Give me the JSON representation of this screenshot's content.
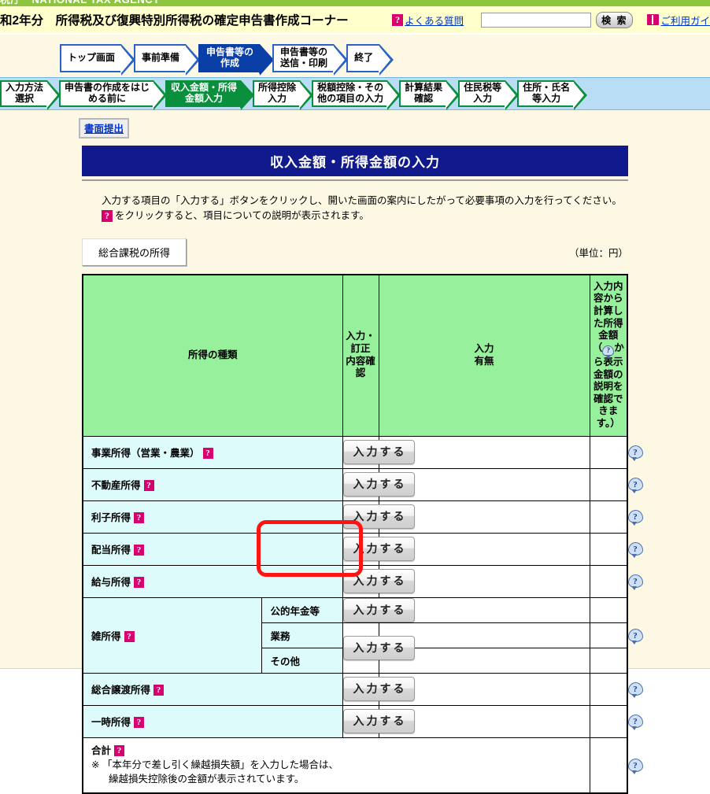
{
  "agency": {
    "strip_text": "税庁　NATIONAL TAX AGENCY"
  },
  "header": {
    "title": "和2年分　所得税及び復興特別所得税の確定申告書作成コーナー",
    "faq_label": "よくある質問",
    "faq_icon": "question-badge-icon",
    "search_value": "",
    "search_placeholder": "",
    "search_button": "検 索",
    "guide_label": "ご利用ガイ",
    "guide_icon": "book-icon"
  },
  "steps": {
    "main": [
      {
        "label": "トップ画面",
        "active": false
      },
      {
        "label": "事前準備",
        "active": false
      },
      {
        "label": "申告書等の\n作成",
        "active": true
      },
      {
        "label": "申告書等の\n送信・印刷",
        "active": false
      },
      {
        "label": "終了",
        "active": false
      }
    ],
    "sub": [
      {
        "label": "入力方法\n選択",
        "active": false
      },
      {
        "label": "申告書の作成をはじ\nめる前に",
        "active": false
      },
      {
        "label": "収入金額・所得\n金額入力",
        "active": true
      },
      {
        "label": "所得控除\n入力",
        "active": false
      },
      {
        "label": "税額控除・その\n他の項目の入力",
        "active": false
      },
      {
        "label": "計算結果\n確認",
        "active": false
      },
      {
        "label": "住民税等\n入力",
        "active": false
      },
      {
        "label": "住所・氏名\n等入力",
        "active": false
      }
    ]
  },
  "submit_tag": "書面提出",
  "page_title": "収入金額・所得金額の入力",
  "instructions": {
    "line1": "入力する項目の「入力する」ボタンをクリックし、開いた画面の案内にしたがって必要事項の入力を行ってください。",
    "line2": "をクリックすると、項目についての説明が表示されます。"
  },
  "section": {
    "button_label": "総合課税の所得",
    "unit_label": "（単位：円）"
  },
  "table": {
    "headers": {
      "kind": "所得の種類",
      "input_confirm": "入力・訂正\n内容確認",
      "has_input": "入力\n有無",
      "amount_line1": "入力内容から計算した所得金額",
      "amount_line2_pre": "（",
      "amount_line2_post": "から表示金額の説明を確認できます。）"
    },
    "input_button_label": "入力する",
    "rows": [
      {
        "label": "事業所得（営業・農業）",
        "help": true,
        "amount": "",
        "has_input": "",
        "bubble": true
      },
      {
        "label": "不動産所得",
        "help": true,
        "amount": "",
        "has_input": "",
        "bubble": true
      },
      {
        "label": "利子所得",
        "help": true,
        "amount": "",
        "has_input": "",
        "bubble": true
      },
      {
        "label": "配当所得",
        "help": true,
        "amount": "",
        "has_input": "",
        "bubble": true
      },
      {
        "label": "給与所得",
        "help": true,
        "amount": "",
        "has_input": "",
        "bubble": true
      }
    ],
    "misc": {
      "label": "雑所得",
      "help": true,
      "bubble": true,
      "sub_rows": [
        {
          "label": "公的年金等",
          "has_button": true
        },
        {
          "label": "業務",
          "has_button": false
        },
        {
          "label": "その他",
          "has_button": false
        }
      ],
      "merged_button": "入力する"
    },
    "rows_after": [
      {
        "label": "総合譲渡所得",
        "help": true,
        "amount": "",
        "has_input": "",
        "bubble": true
      },
      {
        "label": "一時所得",
        "help": true,
        "amount": "",
        "has_input": "",
        "bubble": true
      }
    ],
    "total_row": {
      "label": "合計",
      "help": true,
      "note_mark": "※",
      "note_line1": "「本年分で差し引く繰越損失額」を入力した場合は、",
      "note_line2": "繰越損失控除後の金額が表示されています。",
      "bubble": true
    }
  },
  "annotation": {
    "type": "red-rounded-rectangle",
    "color": "#ff1414",
    "target": "misc-income-input-button"
  }
}
